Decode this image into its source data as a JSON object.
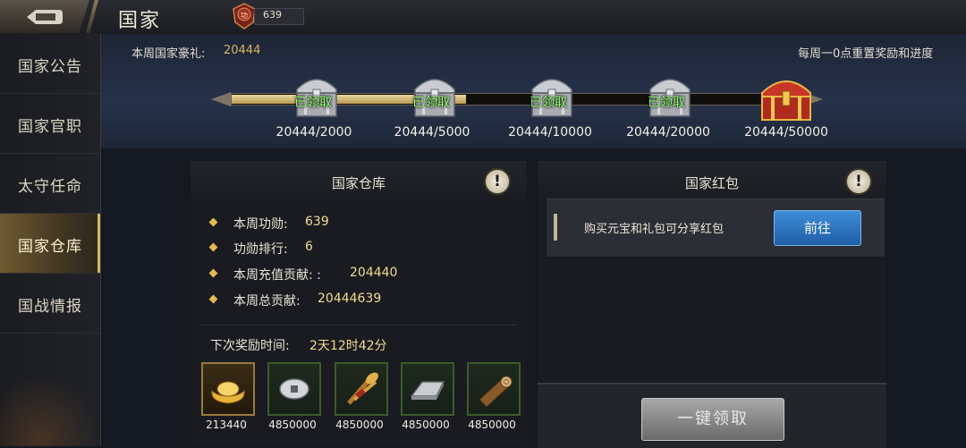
{
  "header": {
    "title": "国家",
    "merit_badge_text": "功",
    "merit_value": "639"
  },
  "sidebar": {
    "items": [
      {
        "label": "国家公告",
        "active": false
      },
      {
        "label": "国家官职",
        "active": false
      },
      {
        "label": "太守任命",
        "active": false
      },
      {
        "label": "国家仓库",
        "active": true
      },
      {
        "label": "国战情报",
        "active": false
      }
    ]
  },
  "weekly_gift": {
    "label": "本周国家豪礼:",
    "value": "20444",
    "reset_note": "每周一0点重置奖励和进度",
    "progress_fraction": 0.41,
    "milestones": [
      {
        "status": "已领取",
        "progress": "20444/2000"
      },
      {
        "status": "已领取",
        "progress": "20444/5000"
      },
      {
        "status": "已领取",
        "progress": "20444/10000"
      },
      {
        "status": "已领取",
        "progress": "20444/20000"
      },
      {
        "status": "",
        "progress": "20444/50000"
      }
    ]
  },
  "warehouse": {
    "title": "国家仓库",
    "stats": [
      {
        "label": "本周功勋:",
        "value": "639"
      },
      {
        "label": "功勋排行:",
        "value": "6"
      },
      {
        "label": "本周充值贡献: :",
        "value": "204440"
      },
      {
        "label": "本周总贡献:",
        "value": "20444639"
      }
    ],
    "next_reward_label": "下次奖励时间:",
    "next_reward_value": "2天12时42分",
    "rewards": [
      {
        "icon": "gold-ingot-icon",
        "qty": "213440"
      },
      {
        "icon": "silver-coin-icon",
        "qty": "4850000"
      },
      {
        "icon": "grain-bundle-icon",
        "qty": "4850000"
      },
      {
        "icon": "iron-bar-icon",
        "qty": "4850000"
      },
      {
        "icon": "wood-log-icon",
        "qty": "4850000"
      }
    ]
  },
  "red_packet": {
    "title": "国家红包",
    "description": "购买元宝和礼包可分享红包",
    "go_label": "前往",
    "claim_all_label": "一键领取"
  },
  "colors": {
    "accent_gold": "#d9b565",
    "claimed_green": "#8dff6a",
    "button_blue": "#2f78c4"
  }
}
